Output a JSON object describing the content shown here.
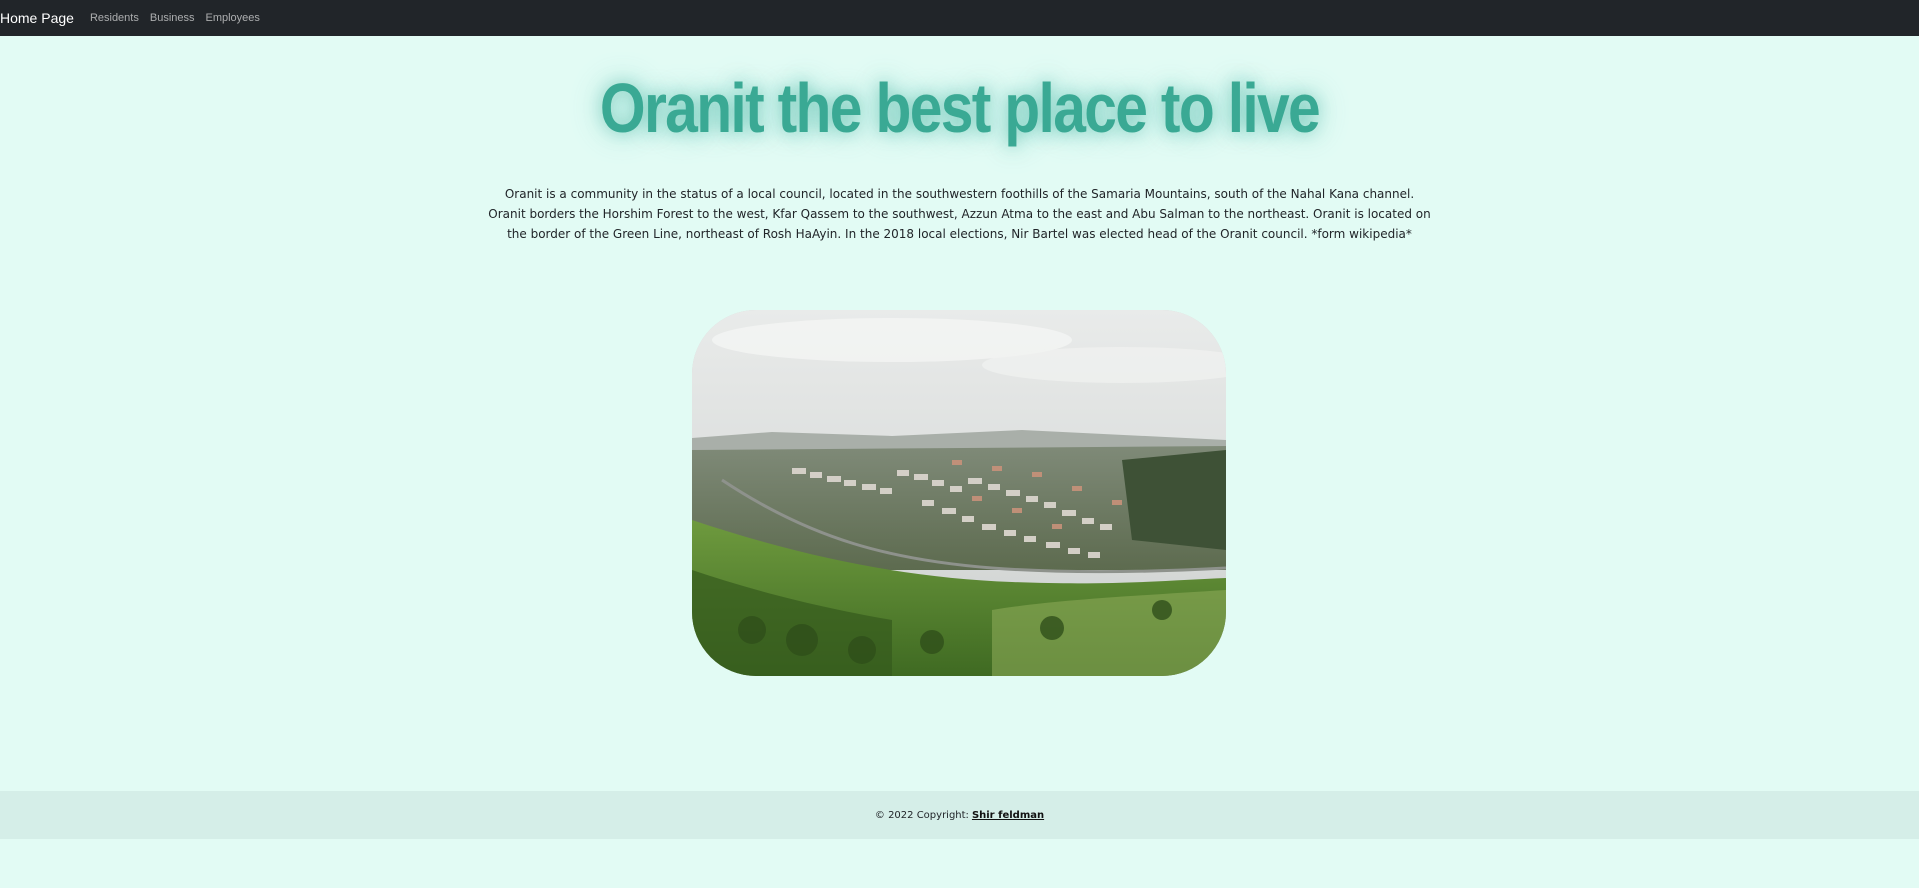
{
  "nav": {
    "brand": "Home Page",
    "links": [
      "Residents",
      "Business",
      "Employees"
    ]
  },
  "hero": {
    "title": "Oranit the best place to live",
    "intro": "Oranit is a community in the status of a local council, located in the southwestern foothills of the Samaria Mountains, south of the Nahal Kana channel. Oranit borders the Horshim Forest to the west, Kfar Qassem to the southwest, Azzun Atma to the east and Abu Salman to the northeast. Oranit is located on the border of the Green Line, northeast of Rosh HaAyin. In the 2018 local elections, Nir Bartel was elected head of the Oranit council. *form wikipedia*"
  },
  "footer": {
    "copyright": "© 2022 Copyright:",
    "author": "Shir feldman"
  },
  "colors": {
    "page_bg": "#e2fbf4",
    "navbar_bg": "#212529",
    "title": "#3aa994",
    "footer_bg": "#d5eee8"
  }
}
